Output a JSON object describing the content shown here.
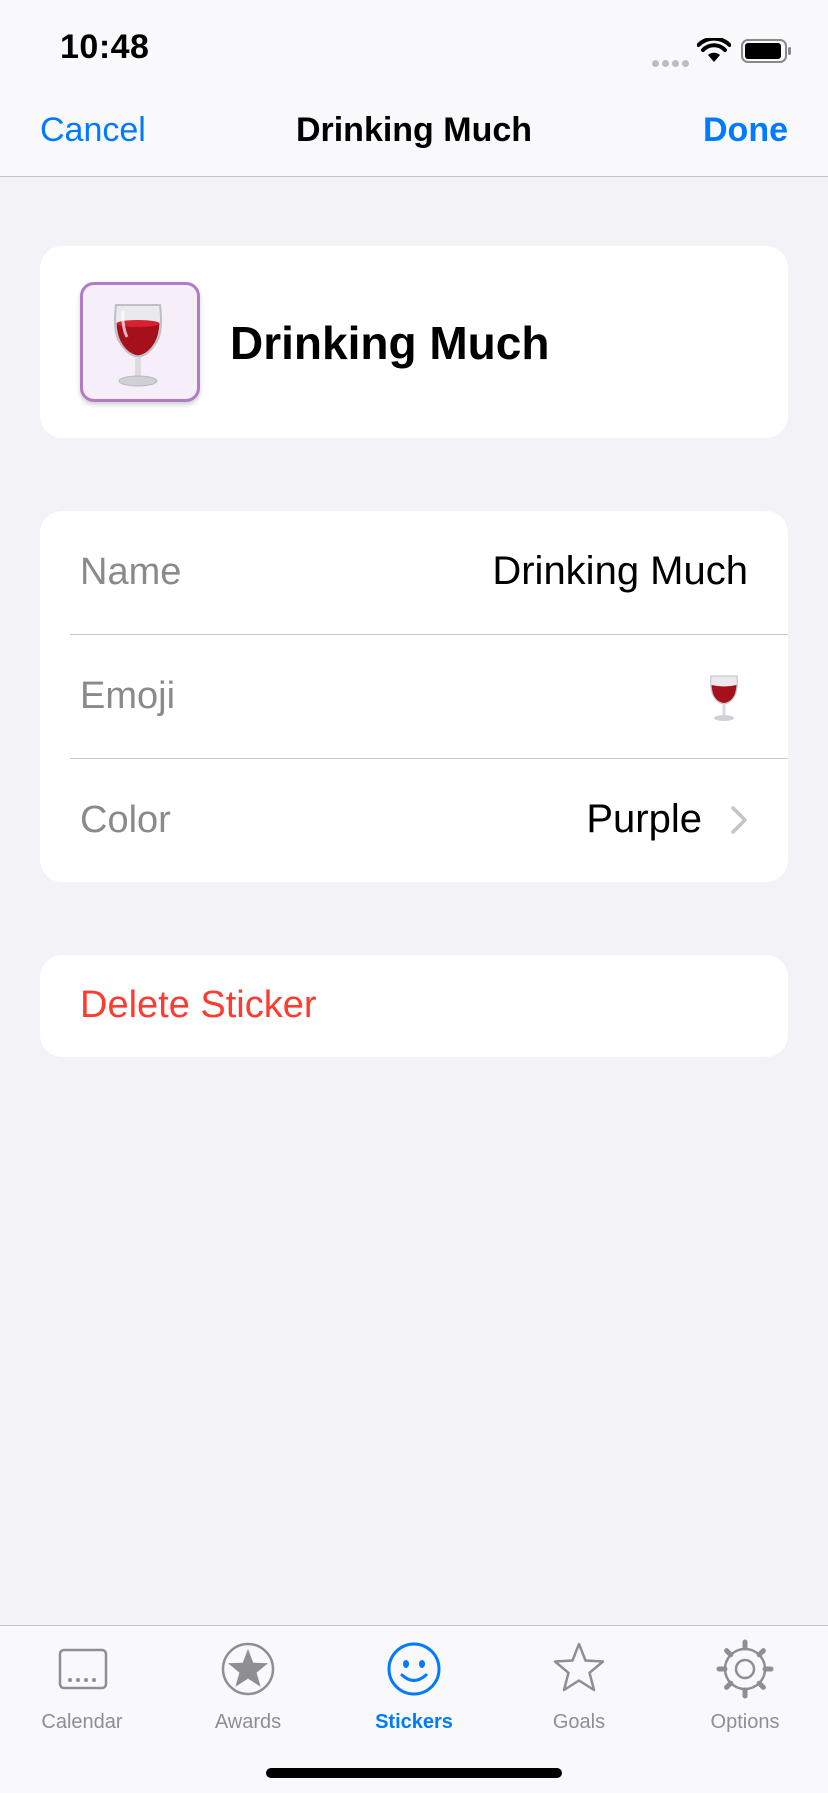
{
  "status_bar": {
    "time": "10:48"
  },
  "nav": {
    "cancel_label": "Cancel",
    "title": "Drinking Much",
    "done_label": "Done"
  },
  "sticker": {
    "name": "Drinking Much",
    "icon": "wine-glass-icon"
  },
  "form": {
    "rows": [
      {
        "label": "Name",
        "value": "Drinking Much"
      },
      {
        "label": "Emoji",
        "value": "wine-glass-emoji"
      },
      {
        "label": "Color",
        "value": "Purple"
      }
    ]
  },
  "delete_label": "Delete Sticker",
  "tabs": [
    {
      "label": "Calendar",
      "icon": "calendar-icon",
      "active": false
    },
    {
      "label": "Awards",
      "icon": "award-star-icon",
      "active": false
    },
    {
      "label": "Stickers",
      "icon": "smiley-icon",
      "active": true
    },
    {
      "label": "Goals",
      "icon": "star-outline-icon",
      "active": false
    },
    {
      "label": "Options",
      "icon": "gear-icon",
      "active": false
    }
  ],
  "colors": {
    "accent": "#007AFF",
    "destructive": "#FF3B30",
    "sticker_purple": "#B07CC6",
    "background": "#F2F2F7"
  }
}
